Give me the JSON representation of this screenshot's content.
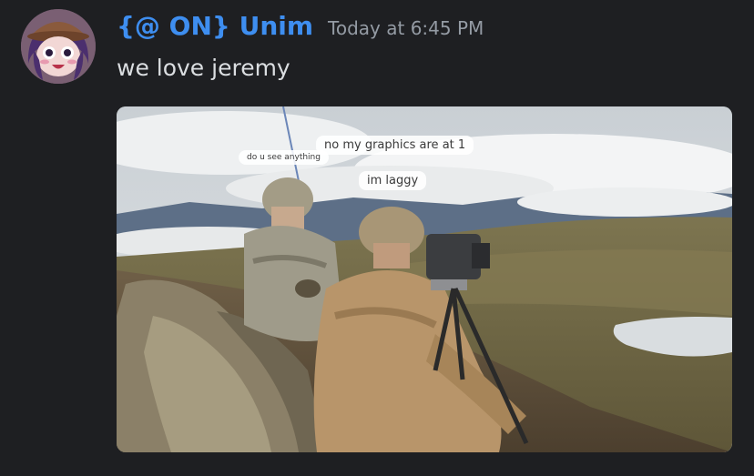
{
  "message": {
    "author": "{@ ON} Unim",
    "timestamp": "Today at 6:45 PM",
    "content": "we love jeremy",
    "author_color": "#3e8ef0"
  },
  "avatar": {
    "icon": "anime-character-avatar"
  },
  "attachment": {
    "icon": "soldiers-photo",
    "captions": [
      "do u see anything",
      "no my graphics are at 1",
      "im laggy"
    ]
  }
}
